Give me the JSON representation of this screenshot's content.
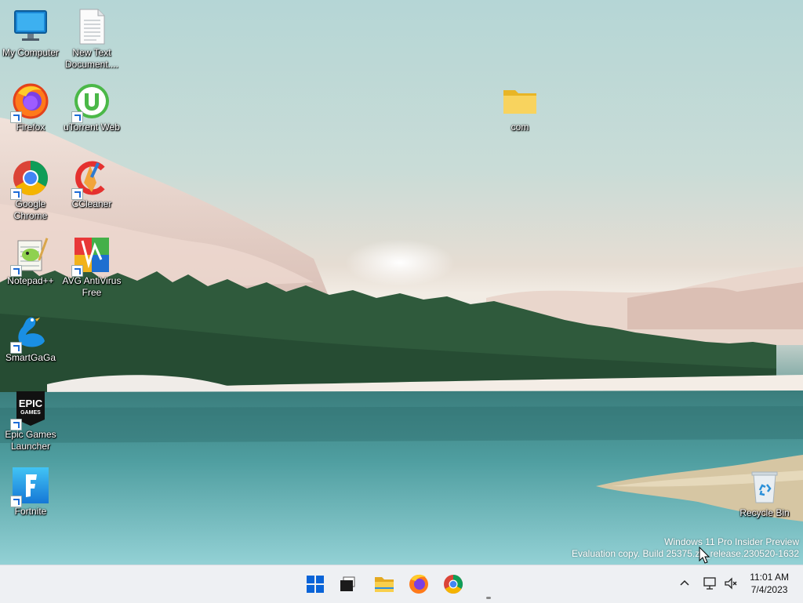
{
  "desktop_icons": [
    {
      "id": "my-computer",
      "label": "My Computer",
      "shortcut": false
    },
    {
      "id": "new-text-document",
      "label": "New Text Document....",
      "shortcut": false
    },
    {
      "id": "firefox",
      "label": "Firefox",
      "shortcut": true
    },
    {
      "id": "utorrent-web",
      "label": "uTorrent Web",
      "shortcut": true
    },
    {
      "id": "google-chrome",
      "label": "Google Chrome",
      "shortcut": true
    },
    {
      "id": "ccleaner",
      "label": "CCleaner",
      "shortcut": true
    },
    {
      "id": "notepad-plus-plus",
      "label": "Notepad++",
      "shortcut": true
    },
    {
      "id": "avg-antivirus",
      "label": "AVG AntiVirus Free",
      "shortcut": true
    },
    {
      "id": "smartgaga",
      "label": "SmartGaGa",
      "shortcut": true
    },
    {
      "id": "epic-games",
      "label": "Epic Games Launcher",
      "shortcut": true
    },
    {
      "id": "fortnite",
      "label": "Fortnite",
      "shortcut": true
    },
    {
      "id": "com-folder",
      "label": "com",
      "shortcut": false
    },
    {
      "id": "recycle-bin",
      "label": "Recycle Bin",
      "shortcut": false
    }
  ],
  "watermark": {
    "line1": "Windows 11 Pro Insider Preview",
    "line2": "Evaluation copy. Build 25375.zn_release.230520-1632"
  },
  "taskbar": {
    "pinned": [
      "start-icon",
      "task-view-icon",
      "file-explorer-icon",
      "firefox-icon",
      "chrome-icon"
    ],
    "tray": {
      "time": "11:01 AM",
      "date": "7/4/2023"
    }
  },
  "colors": {
    "taskbar_bg": "#eef0f3",
    "windows_blue": "#0a64d8",
    "folder_yellow": "#f5c842"
  }
}
